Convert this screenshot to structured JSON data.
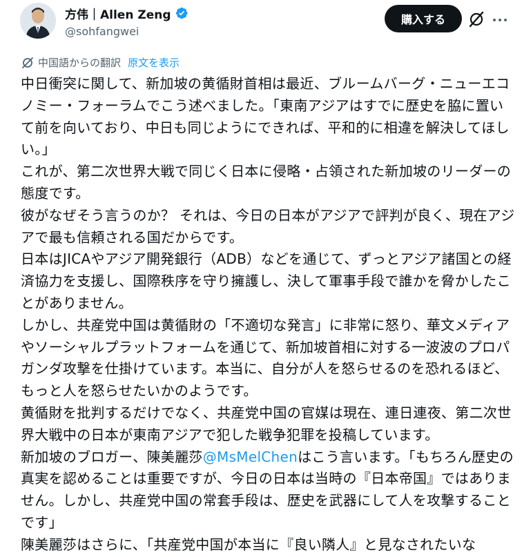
{
  "author": {
    "display_name": "方伟｜Allen Zeng",
    "handle": "@sohfangwei"
  },
  "actions": {
    "buy_label": "購入する"
  },
  "translation": {
    "note": "中国語からの翻訳",
    "show_original": "原文を表示"
  },
  "tweet": {
    "paragraphs": [
      "中日衝突に関して、新加坡の黄循財首相は最近、ブルームバーグ・ニューエコノミー・フォーラムでこう述べました。「東南アジアはすでに歴史を脇に置いて前を向いており、中日も同じようにできれば、平和的に相違を解決してほしい。」",
      "これが、第二次世界大戦で同じく日本に侵略・占領された新加坡のリーダーの態度です。",
      "彼がなぜそう言うのか？ それは、今日の日本がアジアで評判が良く、現在アジアで最も信頼される国だからです。",
      "日本はJICAやアジア開発銀行（ADB）などを通じて、ずっとアジア諸国との経済協力を支援し、国際秩序を守り擁護し、決して軍事手段で誰かを脅かしたことがありません。",
      "しかし、共産党中国は黄循財の「不適切な発言」に非常に怒り、華文メディアやソーシャルプラットフォームを通じて、新加坡首相に対する一波波のプロパガンダ攻撃を仕掛けています。本当に、自分が人を怒らせるのを恐れるほど、もっと人を怒らせたいかのようです。",
      "黄循財を批判するだけでなく、共産党中国の官媒は現在、連日連夜、第二次世界大戦中の日本が東南アジアで犯した戦争犯罪を投稿しています。"
    ],
    "p7_before": "新加坡のブロガー、陳美麗莎",
    "p7_mention": "@MsMelChen",
    "p7_after": "はこう言います。「もちろん歴史の真実を認めることは重要ですが、今日の日本は当時の『日本帝国』ではありません。しかし、共産党中国の常套手段は、歴史を武器にして人を攻撃することです」",
    "p8": "陳美麗莎はさらに、「共産党中国が本当に『良い隣人』と見なされたいな"
  },
  "icons": {
    "verified": "verified-badge-icon",
    "grok": "grok-icon",
    "more": "more-icon",
    "translate": "translate-icon"
  },
  "colors": {
    "accent": "#1d9bf0",
    "text": "#0f1419",
    "secondary": "#536471",
    "button_bg": "#0f1419"
  }
}
